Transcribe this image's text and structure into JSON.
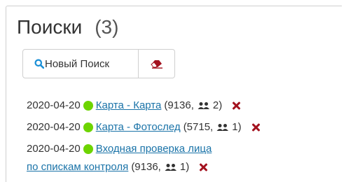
{
  "header": {
    "title": "Поиски",
    "count": "(3)"
  },
  "toolbar": {
    "new_search_label": "Новый Поиск"
  },
  "colors": {
    "status_dot": "#6dd400",
    "link": "#1a73a8",
    "delete": "#a3121f"
  },
  "icons": {
    "search": "search-icon",
    "eraser": "eraser-icon",
    "users": "users-icon",
    "delete": "delete-icon"
  },
  "searches": [
    {
      "date": "2020-04-20",
      "name": "Карта - Карта",
      "open": "(9136,",
      "users": "2)"
    },
    {
      "date": "2020-04-20",
      "name": "Карта - Фотослед",
      "open": "(5715,",
      "users": "1)"
    },
    {
      "date": "2020-04-20",
      "name_line1": "Входная проверка лица",
      "name_line2": "по спискам контроля",
      "open": "(9136,",
      "users": "1)"
    }
  ]
}
